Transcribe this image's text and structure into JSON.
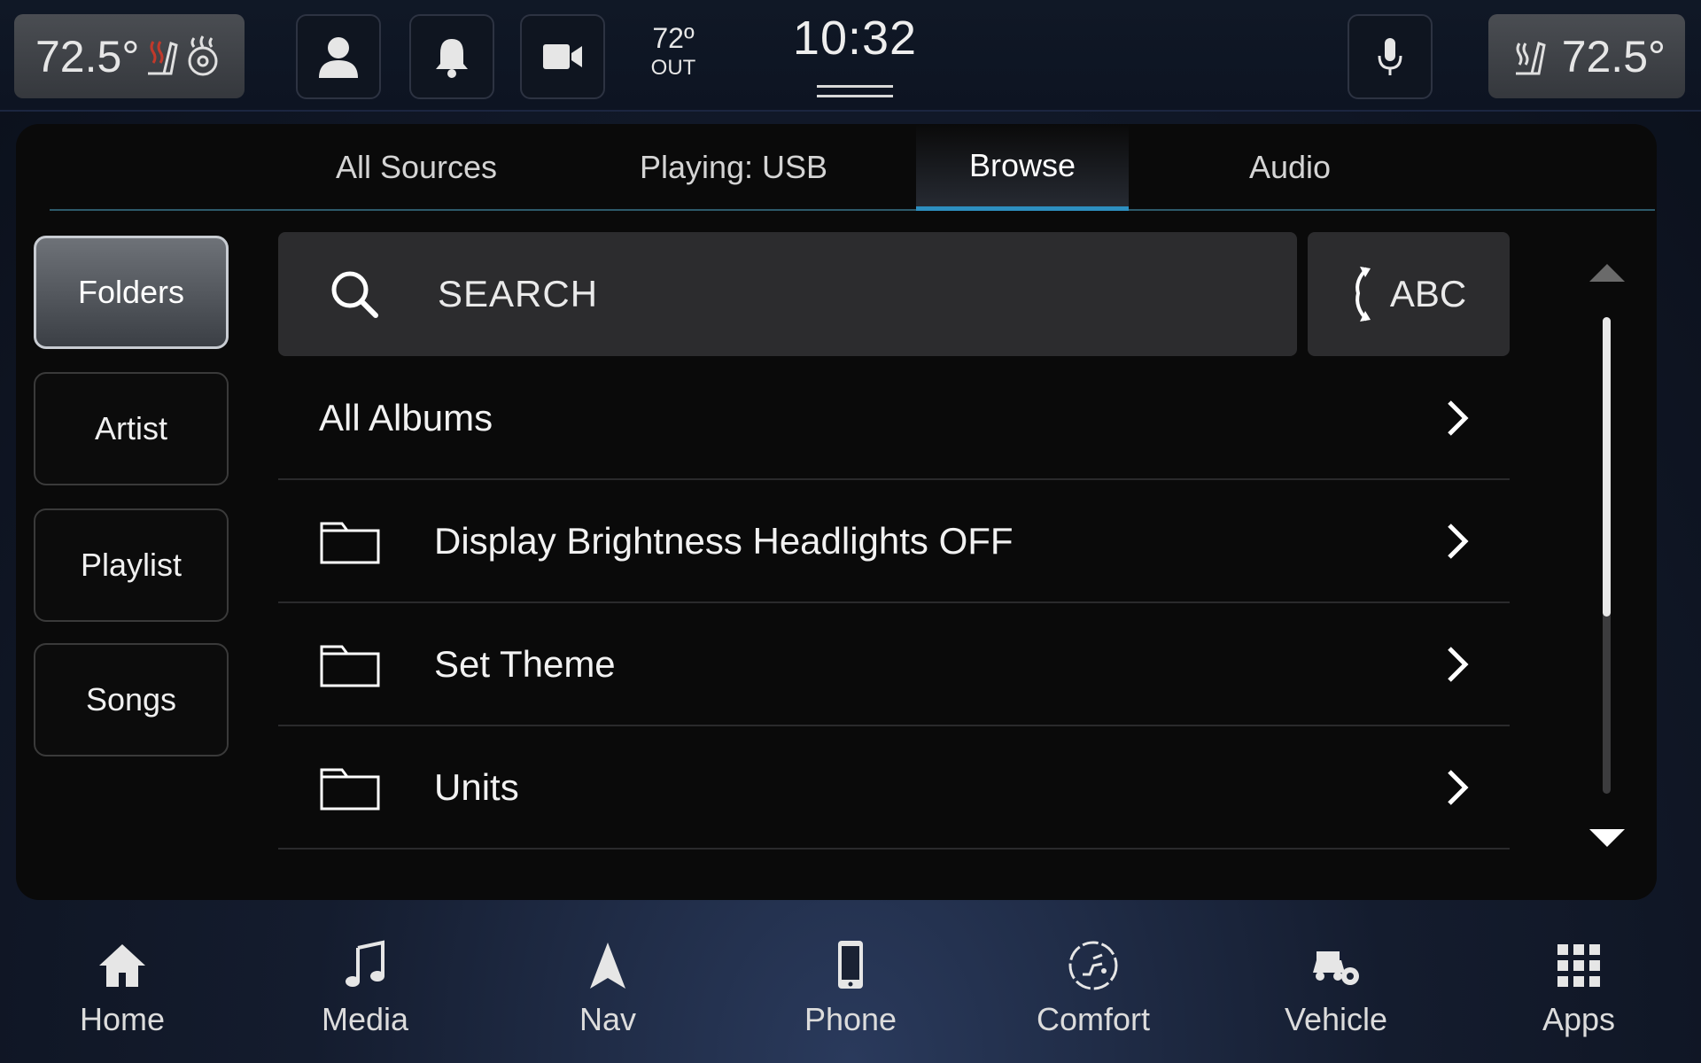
{
  "status_bar": {
    "driver_temp": "72.5°",
    "passenger_temp": "72.5°",
    "outside_temp": "72º",
    "outside_label": "OUT",
    "clock": "10:32"
  },
  "tabs": [
    {
      "label": "All Sources",
      "active": false
    },
    {
      "label": "Playing: USB",
      "active": false
    },
    {
      "label": "Browse",
      "active": true
    },
    {
      "label": "Audio",
      "active": false
    }
  ],
  "categories": [
    {
      "label": "Folders",
      "selected": true
    },
    {
      "label": "Artist",
      "selected": false
    },
    {
      "label": "Playlist",
      "selected": false
    },
    {
      "label": "Songs",
      "selected": false
    }
  ],
  "search": {
    "label": "SEARCH",
    "icon": "search-icon"
  },
  "sort_button": {
    "label": "ABC",
    "icon": "sort-cycle-icon"
  },
  "list_items": [
    {
      "label": "All Albums",
      "icon": null
    },
    {
      "label": "Display Brightness Headlights OFF",
      "icon": "folder-icon"
    },
    {
      "label": "Set Theme",
      "icon": "folder-icon"
    },
    {
      "label": "Units",
      "icon": "folder-icon"
    }
  ],
  "bottom_nav": [
    {
      "label": "Home",
      "icon": "home-icon"
    },
    {
      "label": "Media",
      "icon": "music-note-icon"
    },
    {
      "label": "Nav",
      "icon": "navigation-arrow-icon"
    },
    {
      "label": "Phone",
      "icon": "phone-icon"
    },
    {
      "label": "Comfort",
      "icon": "comfort-icon"
    },
    {
      "label": "Vehicle",
      "icon": "vehicle-settings-icon"
    },
    {
      "label": "Apps",
      "icon": "apps-grid-icon"
    }
  ],
  "colors": {
    "accent_tab_underline": "#2d8fc0",
    "heated_seat_red": "#c0392b",
    "panel_background": "#0a0a0a"
  }
}
